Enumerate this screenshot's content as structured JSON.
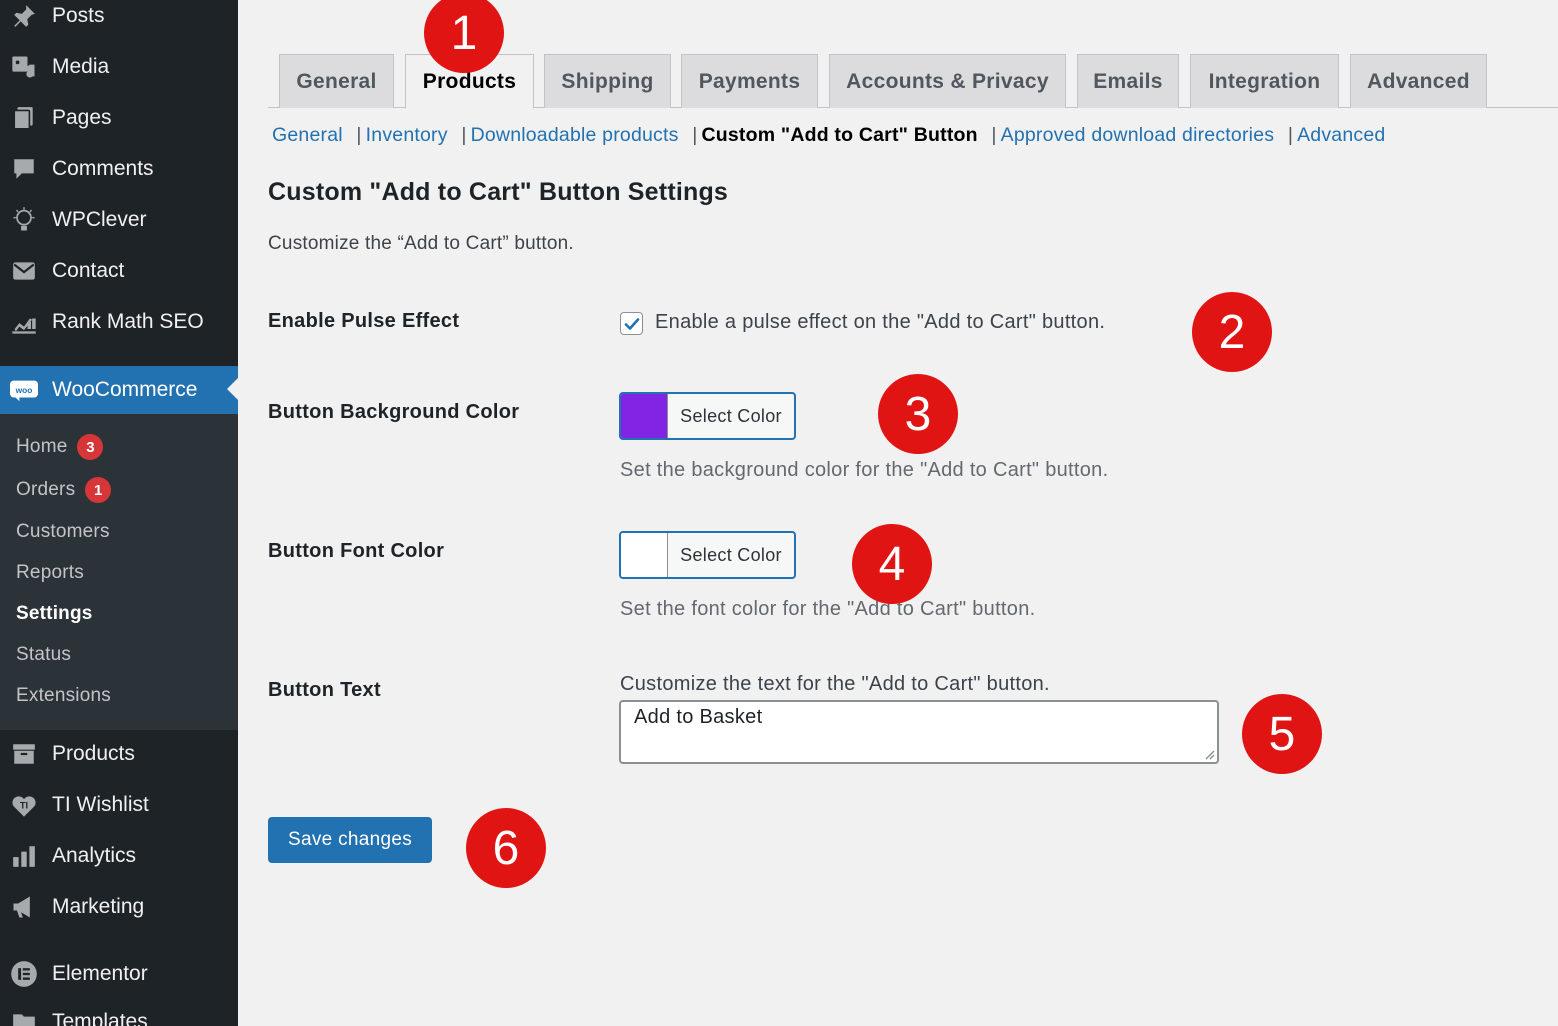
{
  "sidebar": {
    "menu": [
      {
        "label": "Posts",
        "icon": "pin-icon"
      },
      {
        "label": "Media",
        "icon": "media-icon"
      },
      {
        "label": "Pages",
        "icon": "pages-icon"
      },
      {
        "label": "Comments",
        "icon": "comments-icon"
      },
      {
        "label": "WPClever",
        "icon": "wpclever-icon"
      },
      {
        "label": "Contact",
        "icon": "envelope-icon"
      },
      {
        "label": "Rank Math SEO",
        "icon": "rank-math-icon"
      },
      {
        "label": "WooCommerce",
        "icon": "woo-icon"
      }
    ],
    "submenu": [
      {
        "label": "Home",
        "badge": "3"
      },
      {
        "label": "Orders",
        "badge": "1"
      },
      {
        "label": "Customers"
      },
      {
        "label": "Reports"
      },
      {
        "label": "Settings"
      },
      {
        "label": "Status"
      },
      {
        "label": "Extensions"
      }
    ],
    "menu_bottom": [
      {
        "label": "Products",
        "icon": "archive-icon"
      },
      {
        "label": "TI Wishlist",
        "icon": "heart-icon"
      },
      {
        "label": "Analytics",
        "icon": "bar-chart-icon"
      },
      {
        "label": "Marketing",
        "icon": "megaphone-icon"
      },
      {
        "label": "Elementor",
        "icon": "elementor-icon"
      },
      {
        "label": "Templates",
        "icon": "folder-icon"
      }
    ]
  },
  "tabs": [
    {
      "label": "General"
    },
    {
      "label": "Products"
    },
    {
      "label": "Shipping"
    },
    {
      "label": "Payments"
    },
    {
      "label": "Accounts & Privacy"
    },
    {
      "label": "Emails"
    },
    {
      "label": "Integration"
    },
    {
      "label": "Advanced"
    }
  ],
  "active_tab": "Products",
  "sections": [
    {
      "label": "General"
    },
    {
      "label": "Inventory"
    },
    {
      "label": "Downloadable products"
    },
    {
      "label": "Custom \"Add to Cart\" Button"
    },
    {
      "label": "Approved download directories"
    },
    {
      "label": "Advanced"
    }
  ],
  "separator": "|",
  "page": {
    "title": "Custom \"Add to Cart\" Button Settings",
    "description": "Customize the “Add to Cart” button."
  },
  "fields": {
    "pulse": {
      "label": "Enable Pulse Effect",
      "checkbox_label": "Enable a pulse effect on the \"Add to Cart\" button.",
      "checked": true
    },
    "bg_color": {
      "label": "Button Background Color",
      "button_text": "Select Color",
      "color": "#8224e3",
      "description": "Set the background color for the \"Add to Cart\" button."
    },
    "font_color": {
      "label": "Button Font Color",
      "button_text": "Select Color",
      "color": "#ffffff",
      "description": "Set the font color for the \"Add to Cart\" button."
    },
    "button_text": {
      "label": "Button Text",
      "description": "Customize the text for the \"Add to Cart\" button.",
      "value": "Add to Basket"
    }
  },
  "save_label": "Save changes",
  "markers": [
    "1",
    "2",
    "3",
    "4",
    "5",
    "6"
  ],
  "colors": {
    "sidebar_bg": "#1d2327",
    "submenu_bg": "#2c3338",
    "accent": "#2271b1",
    "badge": "#d63638",
    "marker": "#e11414"
  }
}
